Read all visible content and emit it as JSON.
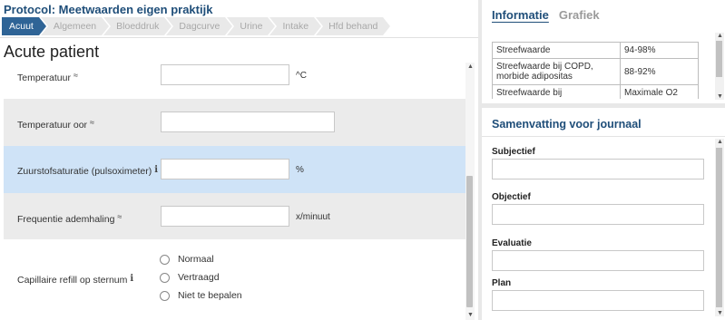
{
  "protocol_title": "Protocol: Meetwaarden eigen praktijk",
  "tabs": [
    {
      "label": "Acuut",
      "active": true
    },
    {
      "label": "Algemeen",
      "active": false
    },
    {
      "label": "Bloeddruk",
      "active": false
    },
    {
      "label": "Dagcurve",
      "active": false
    },
    {
      "label": "Urine",
      "active": false
    },
    {
      "label": "Intake",
      "active": false
    },
    {
      "label": "Hfd behand",
      "active": false
    }
  ],
  "section_title": "Acute patient",
  "fields": [
    {
      "label": "Temperatuur",
      "value": "",
      "unit": "^C"
    },
    {
      "label": "Temperatuur oor",
      "value": "",
      "unit": ""
    },
    {
      "label": "Zuurstofsaturatie (pulsoximeter)",
      "value": "",
      "unit": "%"
    },
    {
      "label": "Frequentie ademhaling",
      "value": "",
      "unit": "x/minuut"
    }
  ],
  "cap_refill": {
    "label": "Capillaire refill op sternum",
    "options": [
      "Normaal",
      "Vertraagd",
      "Niet te bepalen"
    ]
  },
  "right": {
    "tab_info": "Informatie",
    "tab_grafiek": "Grafiek",
    "info_rows": [
      {
        "name": "Streefwaarde",
        "value": "94-98%"
      },
      {
        "name": "Streefwaarde bij COPD, morbide adipositas",
        "value": "88-92%"
      },
      {
        "name": "Streefwaarde bij",
        "value": "Maximale O2"
      }
    ],
    "summary_title": "Samenvatting voor journaal",
    "soep": [
      {
        "label": "Subjectief",
        "value": ""
      },
      {
        "label": "Objectief",
        "value": ""
      },
      {
        "label": "Evaluatie",
        "value": ""
      },
      {
        "label": "Plan",
        "value": ""
      }
    ]
  },
  "icons": {
    "chart_symbol": "≈",
    "info_symbol": "i",
    "scroll_up": "▲",
    "scroll_down": "▼"
  },
  "colors": {
    "accent": "#2f6496",
    "title": "#1f4e79",
    "highlight_row": "#cfe3f7",
    "grey_row": "#ebebeb"
  }
}
